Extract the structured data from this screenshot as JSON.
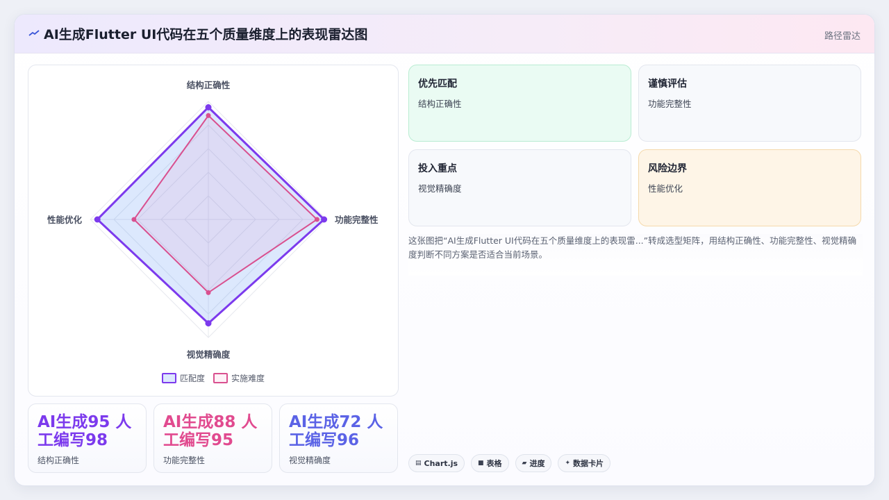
{
  "header": {
    "title": "AI生成Flutter UI代码在五个质量维度上的表现雷达图",
    "right_label": "路径雷达"
  },
  "chart_data": {
    "type": "radar",
    "axes": [
      "结构正确性",
      "功能完整性",
      "视觉精确度",
      "性能优化"
    ],
    "rmax": 100,
    "rings": 5,
    "grid": true,
    "legend_position": "bottom",
    "series": [
      {
        "name": "匹配度",
        "values": [
          95,
          98,
          88,
          94
        ],
        "color": "#7c3aed",
        "fill": "rgba(59,130,246,0.18)"
      },
      {
        "name": "实施难度",
        "values": [
          88,
          92,
          62,
          63
        ],
        "color": "#d9508f",
        "fill": "rgba(236,72,153,0.08)"
      }
    ]
  },
  "stats": [
    {
      "value": "AI生成95 人工编写98",
      "label": "结构正确性",
      "color": "#7c3aed"
    },
    {
      "value": "AI生成88 人工编写95",
      "label": "功能完整性",
      "color": "#e14a8f"
    },
    {
      "value": "AI生成72 人工编写96",
      "label": "视觉精确度",
      "color": "#5b63e6"
    }
  ],
  "insights": [
    {
      "title": "优先匹配",
      "text": "结构正确性"
    },
    {
      "title": "谨慎评估",
      "text": "功能完整性"
    },
    {
      "title": "投入重点",
      "text": "视觉精确度"
    },
    {
      "title": "风险边界",
      "text": "性能优化"
    }
  ],
  "description": "这张图把“AI生成Flutter UI代码在五个质量维度上的表现雷...”转成选型矩阵，用结构正确性、功能完整性、视觉精确度判断不同方案是否适合当前场景。",
  "tags": [
    {
      "icon": "▤",
      "label": "Chart.js"
    },
    {
      "icon": "■",
      "label": "表格"
    },
    {
      "icon": "▰",
      "label": "进度"
    },
    {
      "icon": "✦",
      "label": "数据卡片"
    }
  ]
}
